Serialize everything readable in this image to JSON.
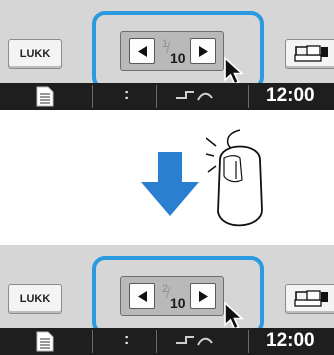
{
  "top_panel": {
    "close_label": "LUKK",
    "page_current": "1",
    "page_total": "10",
    "status_time": "12:00",
    "status_middle_text": ":"
  },
  "bottom_panel": {
    "close_label": "LUKK",
    "page_current": "2",
    "page_total": "10",
    "status_time": "12:00",
    "status_middle_text": ":"
  },
  "colors": {
    "highlight": "#2c9ae0",
    "arrow": "#2a7fd0",
    "panel": "#d6d6d6",
    "status_bar": "#1e1e1e"
  },
  "icons": [
    "prev-arrow-icon",
    "next-arrow-icon",
    "sewing-machine-icon",
    "document-icon",
    "cursor-icon",
    "mouse-icon",
    "down-arrow-icon"
  ]
}
